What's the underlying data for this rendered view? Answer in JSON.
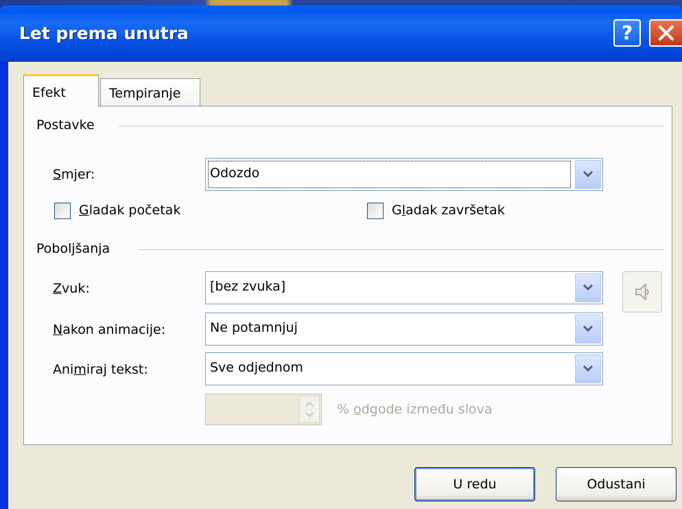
{
  "window": {
    "title": "Let prema unutra",
    "help_label": "?",
    "close_label": "✕"
  },
  "tabs": [
    {
      "label": "Efekt",
      "selected": true
    },
    {
      "label": "Tempiranje",
      "selected": false
    }
  ],
  "settings": {
    "group_label": "Postavke",
    "direction_label_underlined": "S",
    "direction_label_rest": "mjer:",
    "direction_value": "Odozdo",
    "smooth_start_underlined": "G",
    "smooth_start_rest": "ladak početak",
    "smooth_start_checked": false,
    "smooth_end_pre": "G",
    "smooth_end_underlined": "l",
    "smooth_end_rest": "adak završetak",
    "smooth_end_checked": false
  },
  "enhancements": {
    "group_label": "Poboljšanja",
    "sound_label_underlined": "Z",
    "sound_label_rest": "vuk:",
    "sound_value": "[bez zvuka]",
    "after_anim_label_underlined": "N",
    "after_anim_label_rest": "akon animacije:",
    "after_anim_value": "Ne potamnjuj",
    "animate_text_pre": "Ani",
    "animate_text_underlined": "m",
    "animate_text_rest": "iraj tekst:",
    "animate_text_value": "Sve odjednom",
    "delay_value": "",
    "delay_label_pre": "% ",
    "delay_label_underlined": "o",
    "delay_label_rest": "dgode između slova"
  },
  "buttons": {
    "ok_label": "U redu",
    "cancel_label": "Odustani"
  },
  "colors": {
    "titlebar": "#0058ee",
    "dialog_bg": "#ece9d8",
    "close_red": "#d8502a"
  },
  "icons": {
    "dropdown": "chevron-down-icon",
    "sound": "speaker-icon",
    "spinner": "spin-up-down-icon"
  }
}
